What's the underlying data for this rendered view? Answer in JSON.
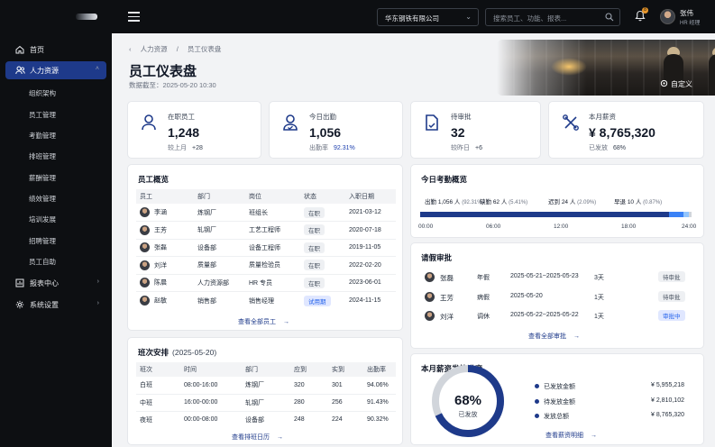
{
  "header": {
    "company": "华东钢铁有限公司",
    "search_placeholder": "搜索员工、功能、报表...",
    "notification_count": "8",
    "user_name": "张伟",
    "user_role": "HR 经理"
  },
  "sidebar": {
    "items": [
      {
        "label": "首页",
        "icon": "home-icon"
      },
      {
        "label": "人力资源",
        "icon": "users-icon"
      },
      {
        "label": "报表中心",
        "icon": "report-icon"
      },
      {
        "label": "系统设置",
        "icon": "gear-icon"
      }
    ],
    "sub_items": [
      "组织架构",
      "员工管理",
      "考勤管理",
      "排班管理",
      "薪酬管理",
      "绩效管理",
      "培训发展",
      "招聘管理",
      "员工自助"
    ]
  },
  "page": {
    "breadcrumb": [
      "人力资源",
      "员工仪表盘"
    ],
    "title": "员工仪表盘",
    "date": "数据截至：2025-05-20  10:30",
    "customize": "自定义"
  },
  "kpis": [
    {
      "label": "在职员工",
      "value": "1,248",
      "sub_label": "较上月",
      "sub_value": "+28",
      "icon": "person-icon"
    },
    {
      "label": "今日出勤",
      "value": "1,056",
      "sub_label": "出勤率",
      "sub_value": "92.31%",
      "icon": "person-check-icon"
    },
    {
      "label": "待审批",
      "value": "32",
      "sub_label": "较昨日",
      "sub_value": "+6",
      "icon": "document-icon"
    },
    {
      "label": "本月薪资",
      "value": "¥ 8,765,320",
      "sub_label": "已发放",
      "sub_value": "68%",
      "icon": "tools-icon"
    }
  ],
  "employees": {
    "title": "员工概览",
    "columns": [
      "员工",
      "部门",
      "岗位",
      "状态",
      "入职日期"
    ],
    "rows": [
      [
        "李涵",
        "炼钢厂",
        "班组长",
        "在职",
        "2021-03-12"
      ],
      [
        "王芳",
        "轧钢厂",
        "工艺工程师",
        "在职",
        "2020-07-18"
      ],
      [
        "张磊",
        "设备部",
        "设备工程师",
        "在职",
        "2019-11-05"
      ],
      [
        "刘洋",
        "质量部",
        "质量检验员",
        "在职",
        "2022-02-20"
      ],
      [
        "陈晨",
        "人力资源部",
        "HR 专员",
        "在职",
        "2023-06-01"
      ],
      [
        "赵敏",
        "销售部",
        "销售经理",
        "试用期",
        "2024-11-15"
      ]
    ],
    "more": "查看全部员工"
  },
  "shifts": {
    "title": "班次安排",
    "date": "(2025-05-20)",
    "columns": [
      "班次",
      "时间",
      "部门",
      "应到",
      "实到",
      "出勤率"
    ],
    "rows": [
      [
        "白班",
        "08:00-16:00",
        "炼钢厂",
        "320",
        "301",
        "94.06%"
      ],
      [
        "中班",
        "16:00-00:00",
        "轧钢厂",
        "280",
        "256",
        "91.43%"
      ],
      [
        "夜班",
        "00:00-08:00",
        "设备部",
        "248",
        "224",
        "90.32%"
      ]
    ],
    "more": "查看排班日历"
  },
  "attendance": {
    "title": "今日考勤概览",
    "items": [
      {
        "label": "出勤",
        "count": "1,056 人",
        "pct": "(92.31%)",
        "color": "#1e3a8a",
        "fraction": 0.9231
      },
      {
        "label": "缺勤",
        "count": "62 人",
        "pct": "(5.41%)",
        "color": "#3b82f6",
        "fraction": 0.0541
      },
      {
        "label": "迟到",
        "count": "24 人",
        "pct": "(2.09%)",
        "color": "#93c5fd",
        "fraction": 0.0209
      },
      {
        "label": "早退",
        "count": "10 人",
        "pct": "(0.87%)",
        "color": "#d1d5db",
        "fraction": 0.0087
      }
    ],
    "ticks": [
      "00:00",
      "06:00",
      "12:00",
      "18:00",
      "24:00"
    ]
  },
  "leaves": {
    "title": "请假审批",
    "rows": [
      {
        "name": "张磊",
        "type": "年假",
        "range": "2025-05-21~2025-05-23",
        "days": "3天",
        "status": "待审批"
      },
      {
        "name": "王芳",
        "type": "病假",
        "range": "2025-05-20",
        "days": "1天",
        "status": "待审批"
      },
      {
        "name": "刘洋",
        "type": "调休",
        "range": "2025-05-22~2025-05-22",
        "days": "1天",
        "status": "审批中"
      }
    ],
    "more": "查看全部审批"
  },
  "payroll": {
    "title": "本月薪资发放进度",
    "percent": "68%",
    "percent_label": "已发放",
    "progress": 0.68,
    "items": [
      {
        "label": "已发放金额",
        "amount": "¥ 5,955,218"
      },
      {
        "label": "待发放金额",
        "amount": "¥ 2,810,102"
      },
      {
        "label": "发放总额",
        "amount": "¥ 8,765,320"
      }
    ],
    "more": "查看薪资明细"
  }
}
